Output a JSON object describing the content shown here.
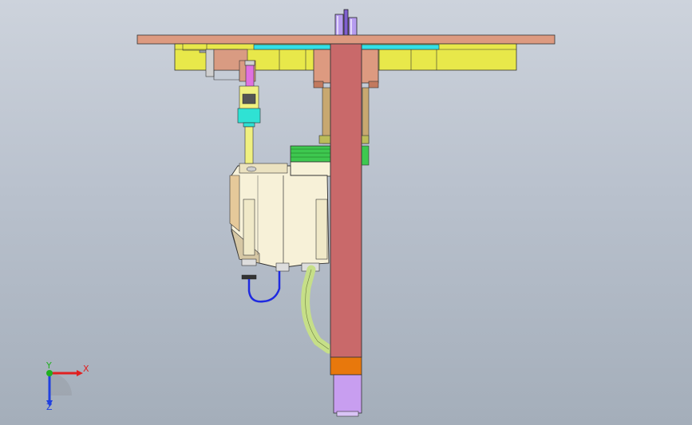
{
  "viewport": {
    "background_top": "#cdd3dc",
    "background_bottom": "#a4aeba"
  },
  "model": {
    "colors": {
      "plate": "#dd9a80",
      "yellow_block": "#e8e84a",
      "cyan_strip": "#33e0e6",
      "column": "#c9696a",
      "column_cap": "#e8780c",
      "base_block": "#c89ef0",
      "top_pipe": "#b69cf0",
      "motor_body": "#f7f1d8",
      "motor_band": "#3ec84f",
      "cable_green": "#c6df88",
      "cable_blue": "#1f2ae0",
      "cylinder_rod": "#f0f080",
      "cylinder_head": "#2fe2d4",
      "cylinder_top": "#e070e0"
    }
  },
  "triad": {
    "x_label": "X",
    "y_label": "Y",
    "z_label": "Z",
    "x_color": "#e02020",
    "y_color": "#20b020",
    "z_color": "#2040e0"
  }
}
